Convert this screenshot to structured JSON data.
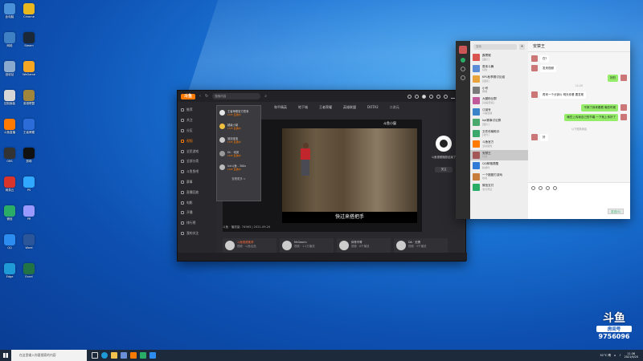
{
  "taskbar": {
    "search_placeholder": "在这里输入你要搜索的内容",
    "weather": "31°C 晴",
    "time": "11:36",
    "date": "2021/9/20"
  },
  "watermark": {
    "logo": "斗鱼",
    "room_label": "房间号",
    "room_number": "9756096"
  },
  "douyu": {
    "logo": "斗鱼",
    "search_placeholder": "搜索内容",
    "menu": [
      {
        "label": "推荐",
        "active": false
      },
      {
        "label": "关注",
        "active": false
      },
      {
        "label": "分区",
        "active": false
      },
      {
        "label": "视频",
        "active": true
      },
      {
        "label": "全民游戏",
        "active": false
      },
      {
        "label": "全部分类",
        "active": false
      },
      {
        "label": "斗鱼鱼吧",
        "active": false
      },
      {
        "label": "赛事",
        "active": false
      },
      {
        "label": "直播回放",
        "active": false
      },
      {
        "label": "电影",
        "active": false
      },
      {
        "label": "开播",
        "active": false
      },
      {
        "label": "排行榜",
        "active": false
      },
      {
        "label": "我的关注",
        "active": false
      }
    ],
    "tabs": [
      "和平精英",
      "地下城",
      "王者荣耀",
      "英雄联盟",
      "DOTA2",
      "二次元"
    ],
    "popup": {
      "items": [
        {
          "name": "王者荣耀官方赛事",
          "sub": "LIVE 直播中"
        },
        {
          "name": "超级小桀",
          "sub": "LIVE 直播中"
        },
        {
          "name": "旭旭宝宝",
          "sub": "LIVE 直播中"
        },
        {
          "name": "DL · 电竞",
          "sub": "LIVE 直播中"
        },
        {
          "name": "Uzi斗鱼 - 300s",
          "sub": "LIVE 直播中"
        }
      ],
      "more": "查看更多 >"
    },
    "video_watermark": "斗鱼小窗",
    "subtitle": "快过来搭把手",
    "video_info": "斗鱼 · 播放量: 74963 | 2021.09.20",
    "right_panel": {
      "text": "斗鱼视频播放结束了",
      "button": "关注"
    },
    "recommendations": [
      {
        "title": "斗鱼视频推荐",
        "sub": "视频 · 斗鱼出品"
      },
      {
        "title": "MrGeorin",
        "sub": "视频 · 1.2万播放"
      },
      {
        "title": "体育不哥",
        "sub": "视频 · 8千播放"
      },
      {
        "title": "DA · 无惧",
        "sub": "视频 · 5千播放"
      }
    ]
  },
  "wechat": {
    "search_placeholder": "搜索",
    "contacts": [
      {
        "name": "霹雳猴",
        "preview": "[图片]",
        "color": "#d9534f"
      },
      {
        "name": "周末斗舞",
        "preview": "好的",
        "color": "#5b8dd6"
      },
      {
        "name": "KPL秋季赛讨论组",
        "preview": "[链接]",
        "color": "#e8a33c"
      },
      {
        "name": "小号",
        "preview": "嗯嗯",
        "color": "#7a7a7a"
      },
      {
        "name": "大腿粉丝群",
        "preview": "[动画表情]",
        "color": "#c05a9a"
      },
      {
        "name": "订阅号",
        "preview": "斗鱼直播",
        "color": "#3b83c9"
      },
      {
        "name": "kpl赛事讨论群",
        "preview": "[图片]",
        "color": "#4aa96c"
      },
      {
        "name": "文件传输助手",
        "preview": "[文件]",
        "color": "#3aa76d"
      },
      {
        "name": "斗鱼官方",
        "preview": "活动通知",
        "color": "#ff7a00"
      },
      {
        "name": "安禁王",
        "preview": "好的",
        "color": "#a35757"
      },
      {
        "name": "QQ邮箱提醒",
        "preview": "新邮件",
        "color": "#2f7bd6"
      },
      {
        "name": "一个圈圈打游戏",
        "preview": "哈哈",
        "color": "#c77d3c"
      },
      {
        "name": "微信支付",
        "preview": "支付凭证",
        "color": "#2aae67"
      }
    ],
    "active_chat": "安禁王",
    "messages": [
      {
        "from": "them",
        "text": "在?"
      },
      {
        "from": "them",
        "text": "发来视频"
      },
      {
        "from": "me",
        "text": "好的"
      },
      {
        "time": "11:20"
      },
      {
        "from": "them",
        "text": "再来一个分钟片 明天你看 要发呢"
      },
      {
        "from": "me",
        "text": "不搞了我来看看 晚些时候"
      },
      {
        "from": "me",
        "text": "晚些上传我自己的节奏 一下就上传好了"
      },
      {
        "time": "以下是新消息"
      },
      {
        "from": "them",
        "text": "好"
      }
    ],
    "send_label": "发送(S)"
  },
  "desktop_icons": [
    {
      "label": "此电脑",
      "color": "#4a90d9"
    },
    {
      "label": "网络",
      "color": "#3f7fc4"
    },
    {
      "label": "回收站",
      "color": "#8aa9cf"
    },
    {
      "label": "控制面板",
      "color": "#d6d6d6"
    },
    {
      "label": "斗鱼直播",
      "color": "#ff7a00"
    },
    {
      "label": "OBS",
      "color": "#333333"
    },
    {
      "label": "网易云",
      "color": "#d9342b"
    },
    {
      "label": "微信",
      "color": "#2aae67"
    },
    {
      "label": "QQ",
      "color": "#2d8cf0"
    },
    {
      "label": "Edge",
      "color": "#1f9ad6"
    },
    {
      "label": "Chrome",
      "color": "#e9b81f"
    },
    {
      "label": "Steam",
      "color": "#1b2838"
    },
    {
      "label": "WeGame",
      "color": "#f5a623"
    },
    {
      "label": "英雄联盟",
      "color": "#a0853c"
    },
    {
      "label": "王者荣耀",
      "color": "#2b6cd9"
    },
    {
      "label": "剪映",
      "color": "#111111"
    },
    {
      "label": "PS",
      "color": "#31a8ff"
    },
    {
      "label": "PR",
      "color": "#9999ff"
    },
    {
      "label": "Word",
      "color": "#2b579a"
    },
    {
      "label": "Excel",
      "color": "#217346"
    }
  ]
}
